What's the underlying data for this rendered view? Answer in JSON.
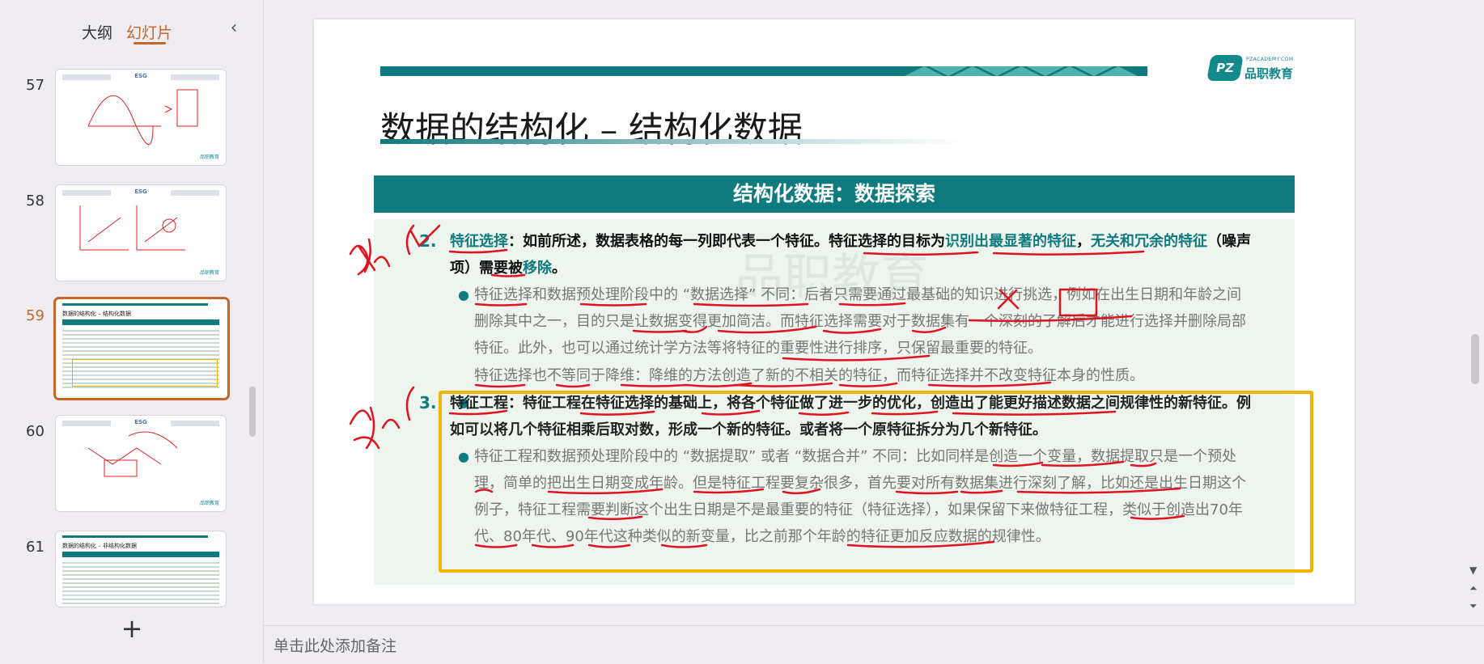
{
  "sidebar": {
    "tab_outline": "大纲",
    "tab_slides": "幻灯片",
    "collapse_icon": "chevron-left-icon",
    "collapse_glyph": "‹",
    "add_glyph": "+",
    "thumbnails": [
      {
        "number": "57",
        "label": "ESG",
        "logo": "品职教育",
        "active": false
      },
      {
        "number": "58",
        "label": "ESG",
        "logo": "品职教育",
        "active": false
      },
      {
        "number": "59",
        "label": "数据的结构化 – 结构化数据",
        "logo": "",
        "active": true
      },
      {
        "number": "60",
        "label": "ESG",
        "logo": "品职教育",
        "active": false
      },
      {
        "number": "61",
        "label": "数据的结构化 – 非结构化数据",
        "logo": "",
        "active": false
      }
    ]
  },
  "slide": {
    "logo_badge": "PZ",
    "logo_small": "PZACADEMY.COM",
    "logo_name": "品职教育",
    "title": "数据的结构化 – 结构化数据",
    "band": "结构化数据：数据探索",
    "watermark": "品职教育",
    "item2_number": "2.",
    "item2_line1_term": "特征选择",
    "item2_line1_rest": "：如前所述，数据表格的每一列即代表一个特征。特征选择的目标为",
    "item2_line1_hl1": "识别出最显著的特征",
    "item2_line1_sep": "，",
    "item2_line1_hl2": "无关和冗余的特征",
    "item2_line1_tail": "（噪声",
    "item2_line2_a": "项）需要被",
    "item2_line2_hl": "移除",
    "item2_line2_end": "。",
    "b1_l1": "特征选择和数据预处理阶段中的 “数据选择” 不同：后者只需要通过最基础的知识进行挑选，例如在出生日期和年龄之间",
    "b1_l2": "删除其中之一，目的只是让数据变得更加简洁。而特征选择需要对于数据集有一个深刻的了解后才能进行选择并删除局部",
    "b1_l3": "特征。此外，也可以通过统计学方法等将特征的重要性进行排序，只保留最重要的特征。",
    "b2_l1": "特征选择也不等同于降维：降维的方法创造了新的不相关的特征，而特征选择并不改变特征本身的性质。",
    "item3_number": "3.",
    "item3_l1": "特征工程：特征工程在特征选择的基础上，将各个特征做了进一步的优化，创造出了能更好描述数据之间规律性的新特征。例",
    "item3_l2": "如可以将几个特征相乘后取对数，形成一个新的特征。或者将一个原特征拆分为几个新特征。",
    "b3_l1": "特征工程和数据预处理阶段中的 “数据提取” 或者 “数据合并” 不同：比如同样是创造一个变量，数据提取只是一个预处",
    "b3_l2": "理，简单的把出生日期变成年龄。但是特征工程要复杂很多，首先要对所有数据集进行深刻了解，比如还是出生日期这个",
    "b3_l3": "例子，特征工程需要判断这个出生日期是不是最重要的特征（特征选择），如果保留下来做特征工程，类似于创造出70年",
    "b3_l4": "代、80年代、90年代这种类似的新变量，比之前那个年龄的特征更加反应数据的规律性。",
    "bullet_glyph": "●"
  },
  "notes": {
    "placeholder": "单击此处添加备注"
  },
  "scroll": {
    "down_glyph": "▼",
    "up2_glyph": "⏶",
    "down2_glyph": "⏷"
  },
  "colors": {
    "accent_orange": "#c5662b",
    "teal": "#0f7b7e",
    "highlight_box": "#f2b400",
    "ink_red": "#e0141e"
  }
}
